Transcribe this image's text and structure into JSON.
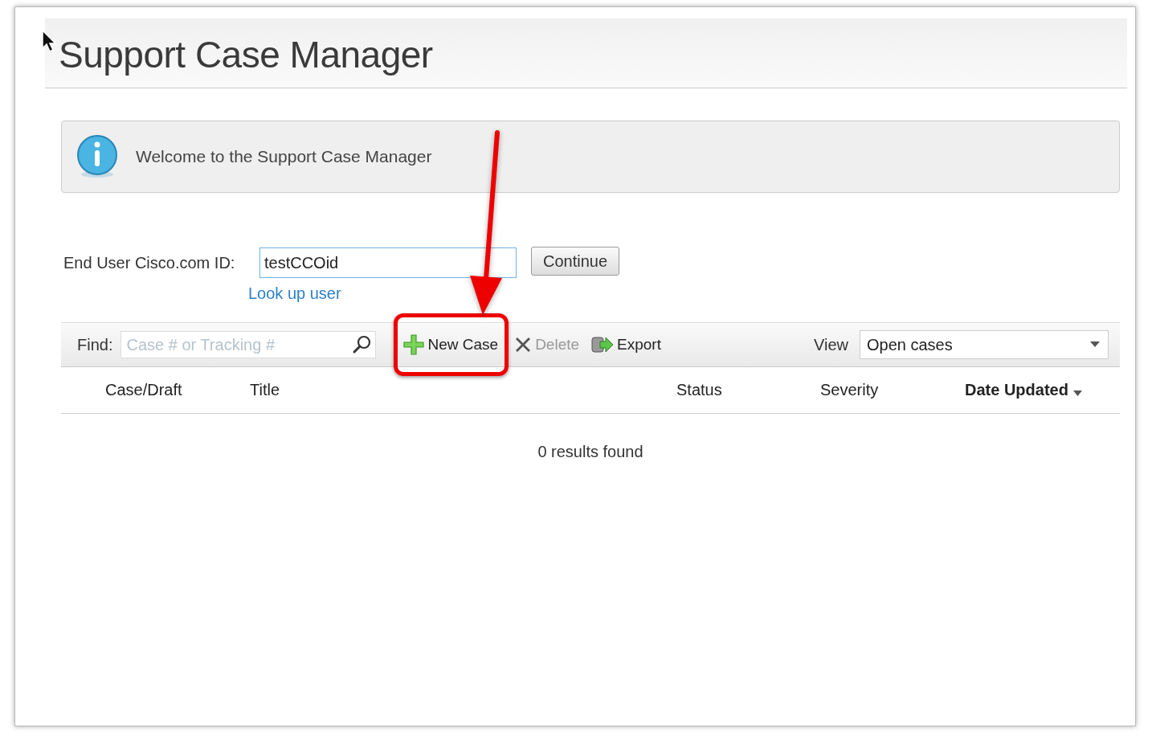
{
  "page": {
    "title": "Support Case Manager"
  },
  "notice": {
    "text": "Welcome to the Support Case Manager"
  },
  "user_id": {
    "label": "End User Cisco.com ID:",
    "value": "testCCOid",
    "button": "Continue",
    "link": "Look up user"
  },
  "toolbar": {
    "find_label": "Find:",
    "find_placeholder": "Case # or Tracking #",
    "actions": [
      {
        "kind": "add",
        "label": "New Case",
        "disabled": false,
        "highlighted": true
      },
      {
        "kind": "delete",
        "label": "Delete",
        "disabled": true,
        "highlighted": false
      },
      {
        "kind": "export",
        "label": "Export",
        "disabled": false,
        "highlighted": false
      }
    ],
    "view_label": "View",
    "view_value": "Open cases"
  },
  "table": {
    "columns": [
      {
        "label": "Case/Draft",
        "sorted": false
      },
      {
        "label": "Title",
        "sorted": false
      },
      {
        "label": "Status",
        "sorted": false
      },
      {
        "label": "Severity",
        "sorted": false
      },
      {
        "label": "Date Updated",
        "sorted": true
      }
    ],
    "empty_message": "0 results found"
  }
}
